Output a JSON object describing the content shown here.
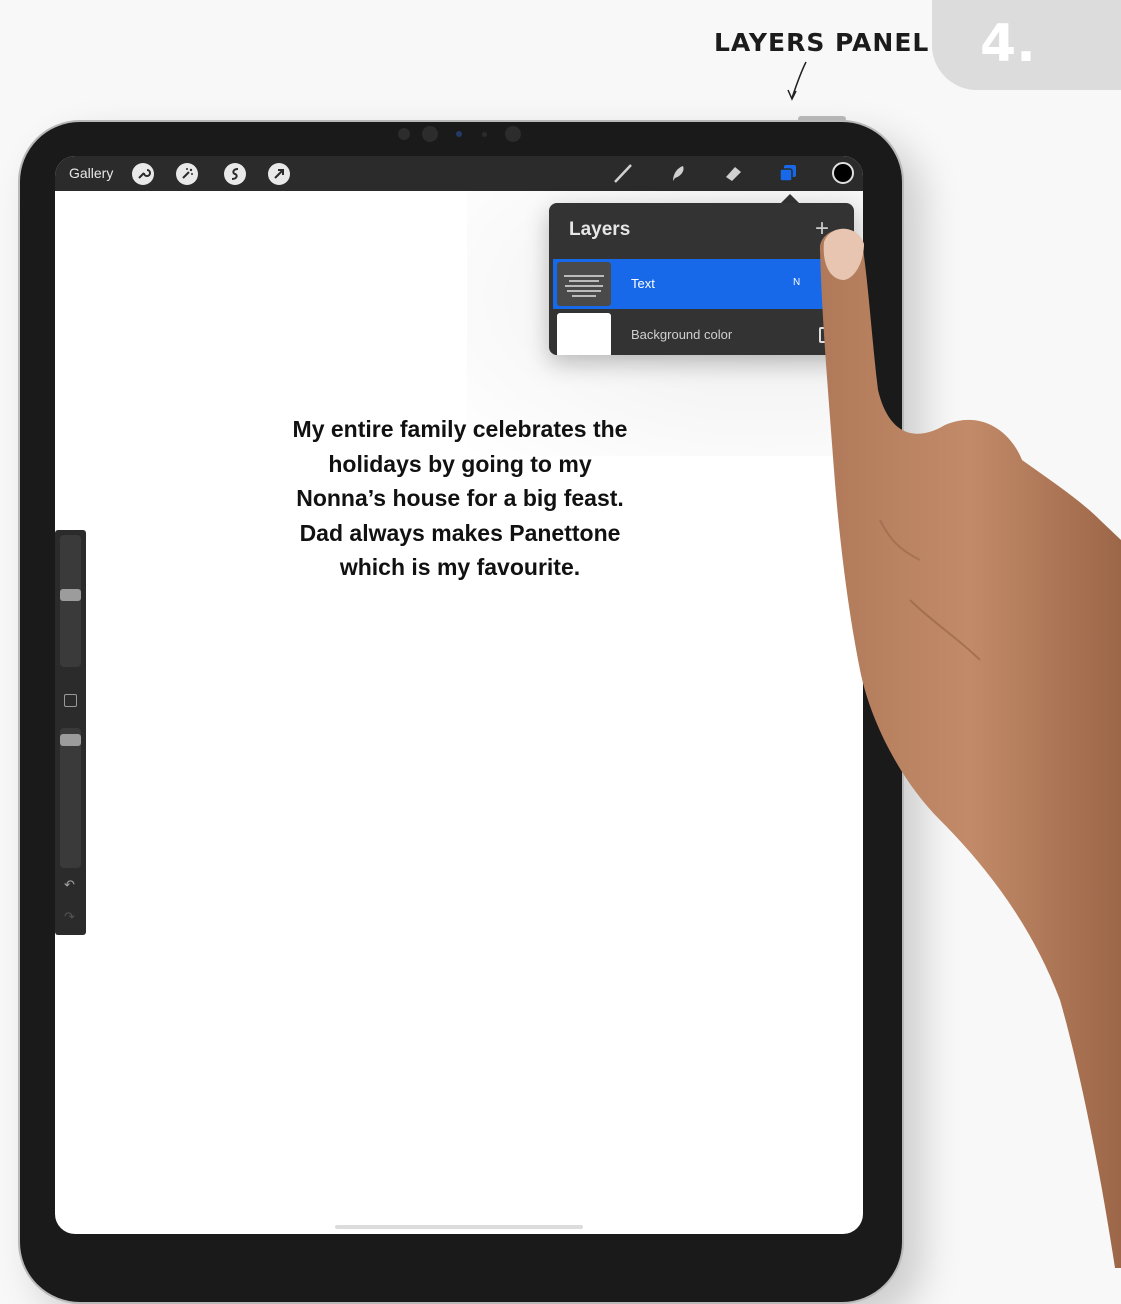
{
  "annotation": {
    "label": "LAYERS PANEL",
    "step": "4."
  },
  "toolbar": {
    "gallery_label": "Gallery",
    "left_tools": [
      "wrench-icon",
      "magic-wand-icon",
      "selection-icon",
      "transform-arrow-icon"
    ],
    "right_tools": [
      "brush-icon",
      "smudge-icon",
      "eraser-icon",
      "layers-icon"
    ],
    "active_tool": "layers-icon",
    "active_color": "#000000",
    "accent": "#1769e9"
  },
  "layers_panel": {
    "title": "Layers",
    "add_symbol": "+",
    "layers": [
      {
        "name": "Text",
        "mode": "N",
        "selected": true
      },
      {
        "name": "Background color",
        "selected": false
      }
    ]
  },
  "canvas": {
    "text_lines": [
      "My entire family celebrates the",
      "holidays by going to my",
      "Nonna’s house for a big feast.",
      "Dad always makes Panettone",
      "which is my favourite."
    ]
  },
  "sidebar": {
    "brush_size_level": 0.5,
    "opacity_level": 0.95,
    "undo_icon": "undo-icon",
    "redo_icon": "redo-icon"
  }
}
